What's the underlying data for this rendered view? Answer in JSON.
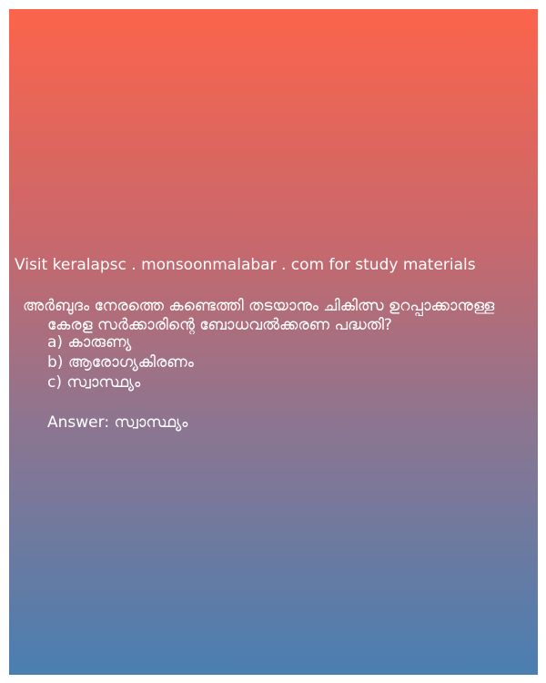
{
  "promo_text": "Visit keralapsc . monsoonmalabar . com for study materials",
  "question": "അർബുദം നേരത്തെ കണ്ടെത്തി തടയാനും  ചികിത്സ ഉറപ്പാക്കാനുള്ള കേരള സർക്കാരിന്റെ ബോധവൽക്കരണ പദ്ധതി?",
  "options": [
    "a) കാരുണ്യ",
    "b) ആരോഗ്യകിരണം",
    "c) സ്വാസ്ഥ്യം"
  ],
  "answer": "Answer: സ്വാസ്ഥ്യം"
}
